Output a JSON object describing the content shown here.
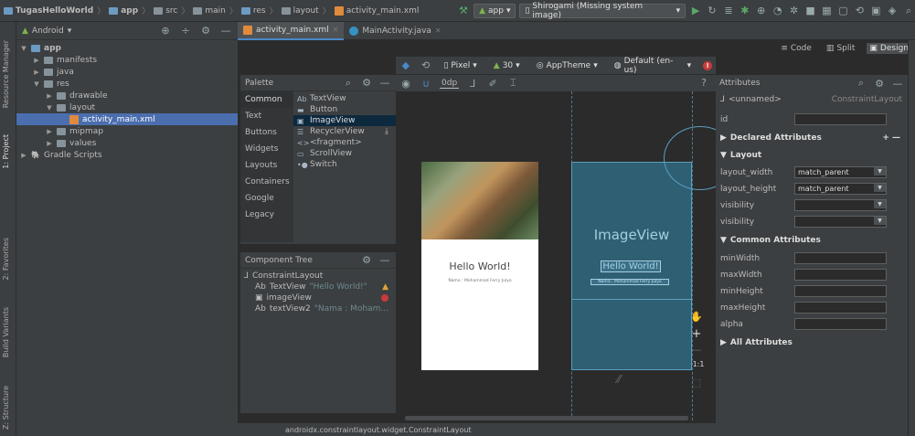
{
  "navbar": {
    "crumbs": [
      "TugasHelloWorld",
      "app",
      "src",
      "main",
      "res",
      "layout",
      "activity_main.xml"
    ],
    "run_config": "app",
    "device": "Shirogami (Missing system image)"
  },
  "leftstrip": {
    "tabs": [
      "Resource Manager",
      "1: Project",
      "2: Favorites",
      "Build Variants",
      "Z: Structure"
    ]
  },
  "project": {
    "view_mode": "Android",
    "tree": [
      {
        "label": "app",
        "indent": 0,
        "arrow": "▼",
        "type": "module"
      },
      {
        "label": "manifests",
        "indent": 1,
        "arrow": "▶",
        "type": "folder"
      },
      {
        "label": "java",
        "indent": 1,
        "arrow": "▶",
        "type": "folder"
      },
      {
        "label": "res",
        "indent": 1,
        "arrow": "▼",
        "type": "folder"
      },
      {
        "label": "drawable",
        "indent": 2,
        "arrow": "▶",
        "type": "folder"
      },
      {
        "label": "layout",
        "indent": 2,
        "arrow": "▼",
        "type": "folder"
      },
      {
        "label": "activity_main.xml",
        "indent": 3,
        "arrow": "",
        "type": "xml",
        "selected": true
      },
      {
        "label": "mipmap",
        "indent": 2,
        "arrow": "▶",
        "type": "folder"
      },
      {
        "label": "values",
        "indent": 2,
        "arrow": "▶",
        "type": "folder"
      },
      {
        "label": "Gradle Scripts",
        "indent": 0,
        "arrow": "▶",
        "type": "gradle"
      }
    ]
  },
  "tabs": [
    {
      "label": "activity_main.xml",
      "active": true
    },
    {
      "label": "MainActivity.java",
      "active": false
    }
  ],
  "viewbar": {
    "code": "Code",
    "split": "Split",
    "design": "Design"
  },
  "palette": {
    "title": "Palette",
    "categories": [
      "Common",
      "Text",
      "Buttons",
      "Widgets",
      "Layouts",
      "Containers",
      "Google",
      "Legacy"
    ],
    "items": [
      {
        "label": "TextView",
        "glyph": "Ab"
      },
      {
        "label": "Button",
        "glyph": "▬"
      },
      {
        "label": "ImageView",
        "glyph": "▣",
        "selected": true
      },
      {
        "label": "RecyclerView",
        "glyph": "☰"
      },
      {
        "label": "<fragment>",
        "glyph": "<>"
      },
      {
        "label": "ScrollView",
        "glyph": "▭"
      },
      {
        "label": "Switch",
        "glyph": "•●"
      }
    ]
  },
  "component_tree": {
    "title": "Component Tree",
    "root": "ConstraintLayout",
    "children": [
      {
        "glyph": "Ab",
        "name": "TextView",
        "hint": "\"Hello World!\"",
        "status": "warn"
      },
      {
        "glyph": "▣",
        "name": "imageView",
        "hint": "",
        "status": "error"
      },
      {
        "glyph": "Ab",
        "name": "textView2",
        "hint": "\"Nama : Moham...",
        "status": "error"
      }
    ]
  },
  "designbar": {
    "device": "Pixel",
    "api": "30",
    "theme": "AppTheme",
    "locale": "Default (en-us)",
    "margin": "0dp"
  },
  "preview": {
    "hello": "Hello World!",
    "name": "Nama : Mohammad Ferry Julyo"
  },
  "blueprint": {
    "image_label": "ImageView",
    "hello": "Hello World!",
    "name": "Nama : Mohammad Ferry Julyo"
  },
  "zoom": {
    "ratio": "1:1"
  },
  "attributes": {
    "title": "Attributes",
    "unnamed": "<unnamed>",
    "type": "ConstraintLayout",
    "id_label": "id",
    "declared": "Declared Attributes",
    "layout_section": "Layout",
    "layout_rows": [
      {
        "label": "layout_width",
        "value": "match_parent"
      },
      {
        "label": "layout_height",
        "value": "match_parent"
      },
      {
        "label": "visibility",
        "value": ""
      },
      {
        "label": "visibility",
        "value": ""
      }
    ],
    "common_section": "Common Attributes",
    "common_rows": [
      "minWidth",
      "maxWidth",
      "minHeight",
      "maxHeight",
      "alpha"
    ],
    "all": "All Attributes"
  },
  "status": {
    "text": "androidx.constraintlayout.widget.ConstraintLayout"
  }
}
